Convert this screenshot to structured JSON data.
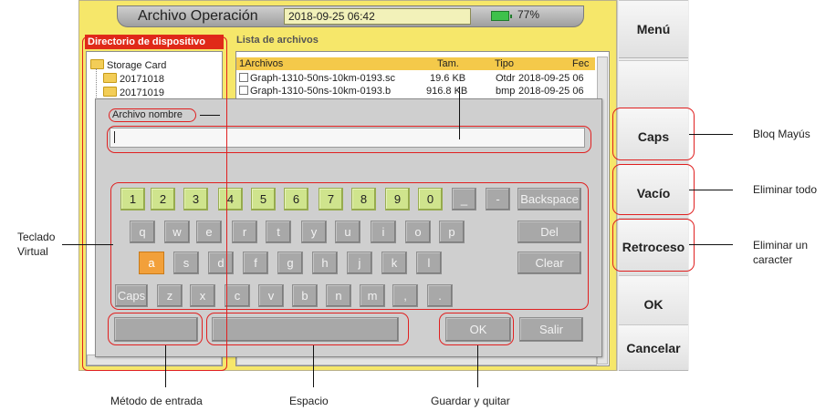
{
  "header": {
    "title": "Archivo Operación",
    "datetime": "2018-09-25 06:42",
    "battery": "77%"
  },
  "panels": {
    "directory_title": "Directorio de dispositivo",
    "files_title": "Lista de archivos"
  },
  "tree": [
    {
      "label": "Storage Card"
    },
    {
      "label": "20171018"
    },
    {
      "label": "20171019"
    }
  ],
  "file_list": {
    "columns": [
      "1Archivos",
      "Tam.",
      "Tipo",
      "Fec"
    ],
    "rows": [
      {
        "name": "Graph-1310-50ns-10km-0193.sc",
        "size": "19.6 KB",
        "type": "Otdr",
        "date": "2018-09-25 06"
      },
      {
        "name": "Graph-1310-50ns-10km-0193.b",
        "size": "916.8 KB",
        "type": "bmp",
        "date": "2018-09-25 06"
      }
    ]
  },
  "dialog": {
    "label": "Archivo nombre",
    "input_value": ""
  },
  "keyboard": {
    "row1": [
      "1",
      "2",
      "3",
      "4",
      "5",
      "6",
      "7",
      "8",
      "9",
      "0",
      "_",
      "-",
      "Backspace"
    ],
    "row2": [
      "q",
      "w",
      "e",
      "r",
      "t",
      "y",
      "u",
      "i",
      "o",
      "p",
      "Del"
    ],
    "row3": [
      "a",
      "s",
      "d",
      "f",
      "g",
      "h",
      "j",
      "k",
      "l",
      "Clear"
    ],
    "row4": [
      "Caps",
      "z",
      "x",
      "c",
      "v",
      "b",
      "n",
      "m",
      ",",
      "."
    ],
    "ok": "OK",
    "exit": "Salir",
    "active_key": "a"
  },
  "side_buttons": [
    "Menú",
    "",
    "Caps",
    "Vacío",
    "Retroceso",
    "OK",
    "Cancelar"
  ],
  "callouts": {
    "caps": "Bloq Mayús",
    "empty": "Eliminar todo",
    "backspace_1": "Eliminar un",
    "backspace_2": "caracter",
    "keyboard_1": "Teclado",
    "keyboard_2": "Virtual",
    "input_method": "Método de entrada",
    "space": "Espacio",
    "save_exit": "Guardar y quitar"
  },
  "colors": {
    "screen_bg": "#f6e76a",
    "active_key": "#f2a03a",
    "numeric_key": "#cfe48d",
    "annotation": "#e02020"
  }
}
